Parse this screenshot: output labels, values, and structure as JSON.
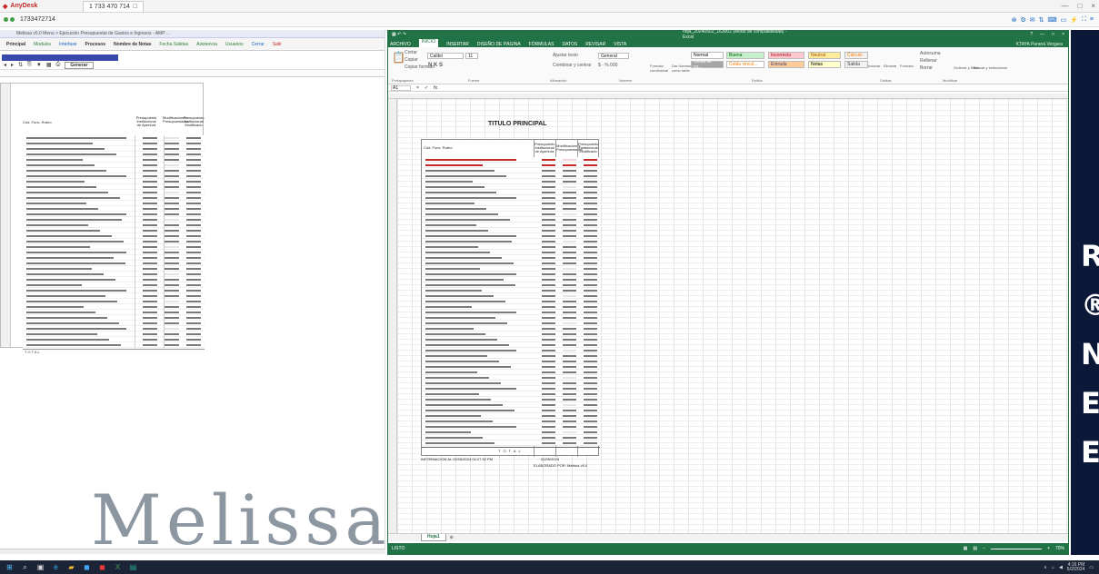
{
  "anydesk": {
    "title": "AnyDesk",
    "tab_label": "1 733 470 714",
    "remote_id": "1733472714",
    "tray_icons": [
      "close-icon",
      "settings-icon",
      "chat-icon",
      "transfer-icon",
      "keyboard-icon",
      "monitor-icon",
      "actions-icon",
      "fullscreen-icon",
      "menu-icon"
    ],
    "window_controls": [
      "—",
      "□",
      "×"
    ]
  },
  "left_app": {
    "titlebar": "Melissa v5.0 Menu > Ejecución Presupuestal de Gastos e Ingresos - AMP ...",
    "menu": {
      "principal": "Principal",
      "modulos": "Modulos",
      "interfase": "Interfase",
      "procesos": "Procesos",
      "nombre_notas": "Nombre de Notas",
      "fecha_salidas": "Fecha Salidas",
      "asistencia": "Asistencia",
      "usuarios": "Usuarios",
      "cerrar": "Cerrar",
      "salir": "Salir"
    },
    "toolbar": {
      "generar": "Generar"
    },
    "table": {
      "col_header": "Cód. Func. Rubro",
      "h1": "Presupuesto Institucional de Apertura",
      "h2": "Modificaciones Presupuestarias",
      "h3": "Presupuesto Institucional Modificado",
      "total_label": "T O T A L"
    },
    "logo_text": "Melissa"
  },
  "excel": {
    "title": "hoja_20240502_163002 (Modo de compatibilidad) - Excel",
    "tabs": [
      "ARCHIVO",
      "INICIO",
      "INSERTAR",
      "DISEÑO DE PÁGINA",
      "FÓRMULAS",
      "DATOS",
      "REVISAR",
      "VISTA"
    ],
    "user": "KTAYA Paraná Vergara",
    "ribbon": {
      "cortar": "Cortar",
      "copiar": "Copiar",
      "copiar_formato": "Copiar formato",
      "font": "Calibri",
      "size": "11",
      "ajustar": "Ajustar texto",
      "combinar": "Combinar y centrar",
      "number_format": "General",
      "formato_condicional": "Formato condicional",
      "dar_formato": "Dar formato como tabla",
      "autosuma": "Autosuma",
      "rellenar": "Rellenar",
      "borrar": "Borrar",
      "ordenar": "Ordenar y filtrar",
      "buscar": "Buscar y seleccionar",
      "insertar": "Insertar",
      "eliminar": "Eliminar",
      "formato": "Formato",
      "styles": [
        {
          "label": "Normal",
          "bg": "#ffffff",
          "fg": "#000000"
        },
        {
          "label": "Buena",
          "bg": "#c6efce",
          "fg": "#006100"
        },
        {
          "label": "Incorrecto",
          "bg": "#ffc7ce",
          "fg": "#9c0006"
        },
        {
          "label": "Neutral",
          "bg": "#ffeb9c",
          "fg": "#9c5700"
        },
        {
          "label": "Cálculo",
          "bg": "#f2f2f2",
          "fg": "#fa7d00"
        },
        {
          "label": "Celda de co...",
          "bg": "#a5a5a5",
          "fg": "#ffffff"
        },
        {
          "label": "Celda vincul...",
          "bg": "#ffffff",
          "fg": "#fa7d00"
        },
        {
          "label": "Entrada",
          "bg": "#ffcc99",
          "fg": "#3f3f76"
        },
        {
          "label": "Notas",
          "bg": "#ffffcc",
          "fg": "#000000"
        },
        {
          "label": "Salida",
          "bg": "#f2f2f2",
          "fg": "#3f3f3f"
        }
      ],
      "groups": {
        "portapapeles": "Portapapeles",
        "fuente": "Fuente",
        "alineacion": "Alineación",
        "numero": "Número",
        "estilos": "Estilos",
        "celdas": "Celdas",
        "modificar": "Modificar"
      }
    },
    "name_box": "A1",
    "sheet": {
      "title": "TITULO PRINCIPAL",
      "col_header": "Cód. Func. Rubro",
      "h1": "Presupuesto Institucional de Apertura",
      "h2": "Modificaciones Presupuestarias",
      "h3": "Presupuesto Institucional Modificado",
      "total_label": "T O T A L",
      "footer1": "INFORMACION AL 02/05/2024 04:27:32 PM",
      "footer_date": "02/05/2024",
      "footer2": "ELABORADO POR:",
      "footer2_value": "Melissa v5.0"
    },
    "sheet_tab": "Hoja1",
    "status": "LISTO",
    "zoom": "70%"
  },
  "taskbar": {
    "icons": [
      "windows-icon",
      "search-icon",
      "task-view-icon",
      "edge-icon",
      "file-explorer-icon",
      "store-icon",
      "office-icon",
      "excel-icon",
      "terminal-icon"
    ],
    "clock_time": "4:16 PM",
    "clock_date": "5/2/2024"
  }
}
